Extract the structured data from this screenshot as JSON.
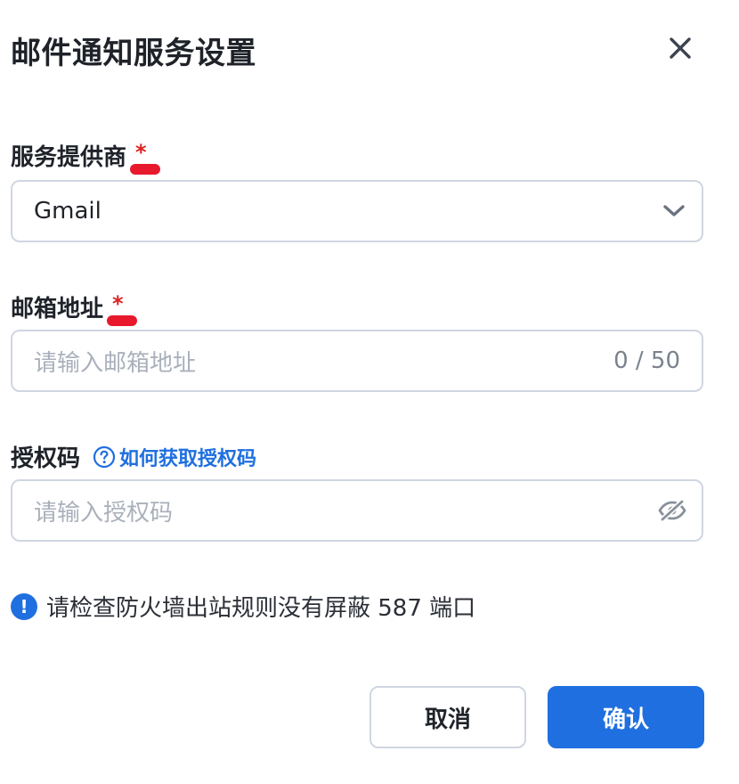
{
  "dialog": {
    "title": "邮件通知服务设置"
  },
  "provider": {
    "label": "服务提供商",
    "required_mark": "*",
    "value": "Gmail"
  },
  "email": {
    "label": "邮箱地址",
    "required_mark": "*",
    "placeholder": "请输入邮箱地址",
    "counter": "0 / 50"
  },
  "auth_code": {
    "label": "授权码",
    "help_link": "如何获取授权码",
    "placeholder": "请输入授权码"
  },
  "notice": {
    "text": "请检查防火墙出站规则没有屏蔽 587 端口",
    "icon_glyph": "!"
  },
  "buttons": {
    "cancel": "取消",
    "confirm": "确认"
  },
  "colors": {
    "accent": "#1f6fe0",
    "required": "#e02020",
    "border": "#d0d6e0"
  },
  "icons": {
    "close": "close-icon",
    "dropdown": "chevron-down-icon",
    "help": "question-circle-icon",
    "visibility": "eye-off-icon",
    "notice": "info-exclamation-icon"
  }
}
